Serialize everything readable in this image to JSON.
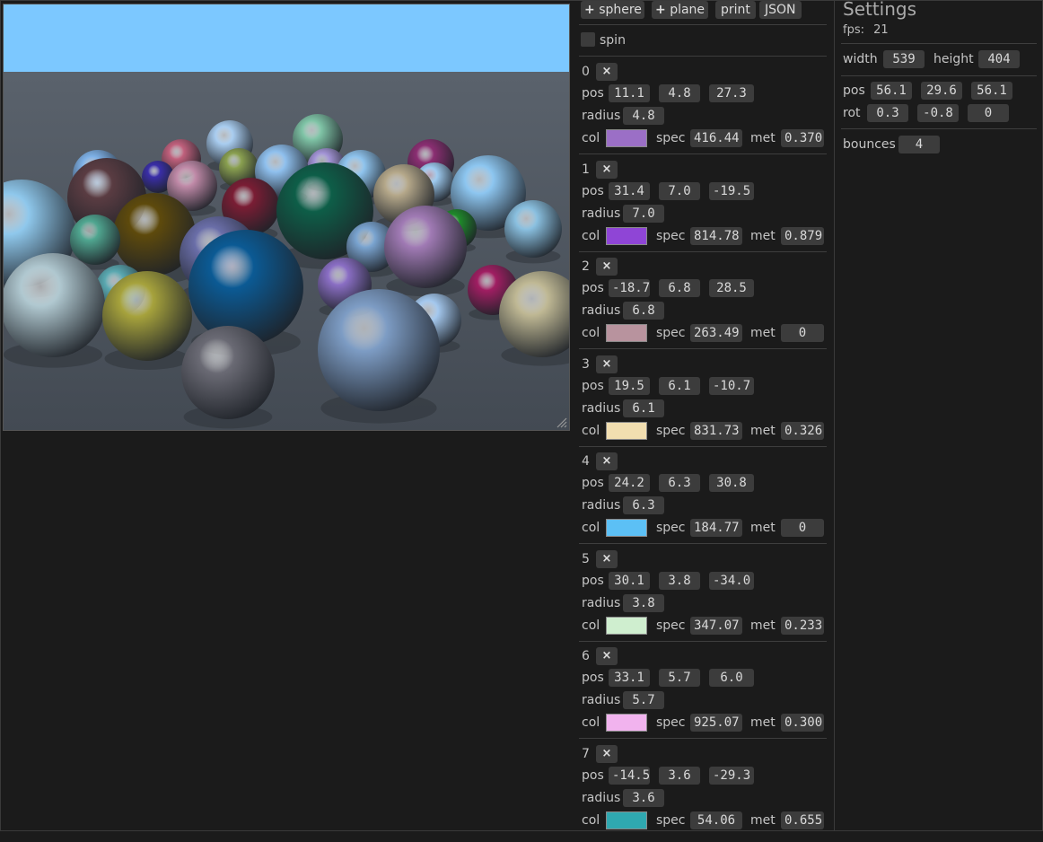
{
  "toolbar": {
    "add_sphere": "sphere",
    "add_plane": "plane",
    "print": "print",
    "json": "JSON",
    "spin_label": "spin"
  },
  "labels": {
    "pos": "pos",
    "radius": "radius",
    "col": "col",
    "spec": "spec",
    "met": "met",
    "remove": "×"
  },
  "objects": [
    {
      "index": "0",
      "pos": [
        "11.1",
        "4.8",
        "27.3"
      ],
      "radius": "4.8",
      "color": "#9b6fc6",
      "spec": "416.44",
      "met": "0.370"
    },
    {
      "index": "1",
      "pos": [
        "31.4",
        "7.0",
        "-19.5"
      ],
      "radius": "7.0",
      "color": "#8f45d6",
      "spec": "814.78",
      "met": "0.879"
    },
    {
      "index": "2",
      "pos": [
        "-18.7",
        "6.8",
        "28.5"
      ],
      "radius": "6.8",
      "color": "#b8939e",
      "spec": "263.49",
      "met": "0"
    },
    {
      "index": "3",
      "pos": [
        "19.5",
        "6.1",
        "-10.7"
      ],
      "radius": "6.1",
      "color": "#f1deb0",
      "spec": "831.73",
      "met": "0.326"
    },
    {
      "index": "4",
      "pos": [
        "24.2",
        "6.3",
        "30.8"
      ],
      "radius": "6.3",
      "color": "#5cc0f5",
      "spec": "184.77",
      "met": "0"
    },
    {
      "index": "5",
      "pos": [
        "30.1",
        "3.8",
        "-34.0"
      ],
      "radius": "3.8",
      "color": "#cfeecf",
      "spec": "347.07",
      "met": "0.233"
    },
    {
      "index": "6",
      "pos": [
        "33.1",
        "5.7",
        "6.0"
      ],
      "radius": "5.7",
      "color": "#f1b3ee",
      "spec": "925.07",
      "met": "0.300"
    },
    {
      "index": "7",
      "pos": [
        "-14.5",
        "3.6",
        "-29.3"
      ],
      "radius": "3.6",
      "color": "#2fa8b0",
      "spec": "54.06",
      "met": "0.655"
    }
  ],
  "settings": {
    "title": "Settings",
    "fps_label": "fps:",
    "fps": "21",
    "width_label": "width",
    "width": "539",
    "height_label": "height",
    "height": "404",
    "pos_label": "pos",
    "pos": [
      "56.1",
      "29.6",
      "56.1"
    ],
    "rot_label": "rot",
    "rot": [
      "0.3",
      "-0.8",
      "0"
    ],
    "bounces_label": "bounces",
    "bounces": "4"
  },
  "scene": {
    "sky_color": "#7cc8ff",
    "ground_color": "#4b535d"
  }
}
